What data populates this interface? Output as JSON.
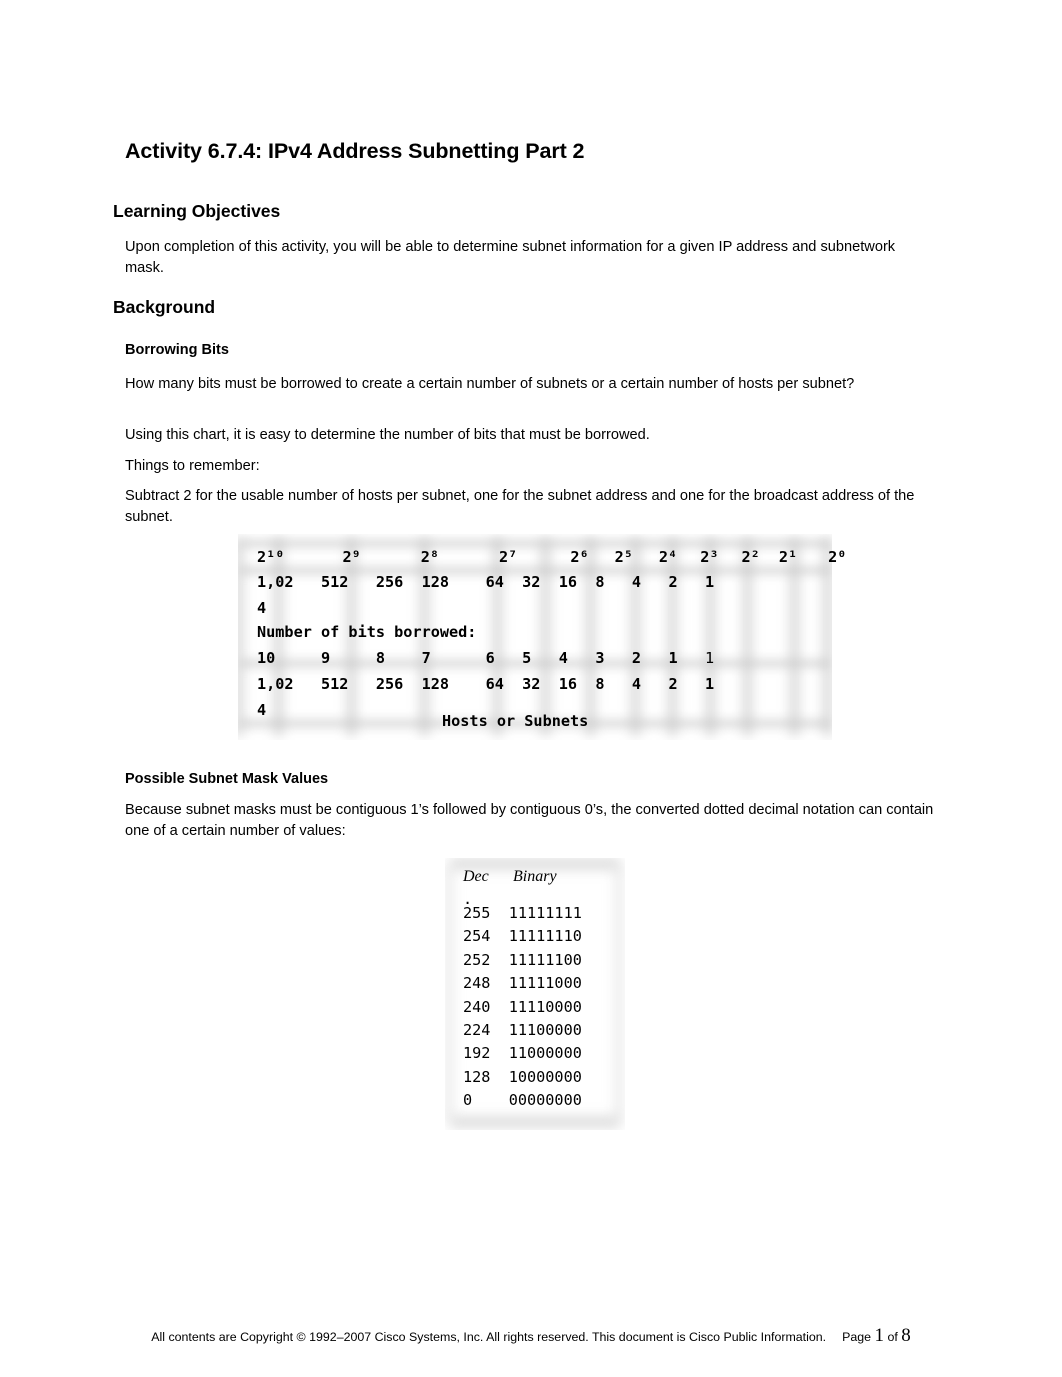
{
  "document": {
    "title": "Activity 6.7.4: IPv4 Address Subnetting Part 2"
  },
  "sections": {
    "learning_objectives": {
      "heading": "Learning Objectives",
      "body": "Upon completion of this activity, you will be able to determine subnet information for a given IP address and subnetwork mask."
    },
    "background": {
      "heading": "Background",
      "borrowing_bits": {
        "heading": "Borrowing Bits",
        "p1": "How many bits must be borrowed to create a certain number of subnets or a certain number of hosts per subnet?",
        "p2": "Using this chart, it is easy to determine the number of bits that must be borrowed.",
        "p3": "Things to remember:",
        "p4": "Subtract 2 for the usable number of hosts per subnet, one for the subnet address and one for the broadcast address of the subnet."
      },
      "subnet_mask_values": {
        "heading": "Possible Subnet Mask Values",
        "p1": "Because subnet masks must be contiguous 1’s followed by contiguous 0’s, the converted dotted decimal notation can contain one of a certain number of values:"
      }
    }
  },
  "chart_data": {
    "type": "table",
    "title": "Borrowing Bits chart",
    "footer_label": "Hosts or Subnets",
    "mid_label": "Number of bits borrowed:",
    "powers_row": [
      "2¹⁰",
      "2⁹",
      "2⁸",
      "2⁷",
      "2⁶",
      "2⁵",
      "2⁴",
      "2³",
      "2²",
      "2¹",
      "2⁰"
    ],
    "powers_base": [
      "2",
      "2",
      "2",
      "2",
      "2",
      "2",
      "2",
      "2",
      "2",
      "2",
      "2"
    ],
    "powers_exp": [
      "10",
      "9",
      "8",
      "7",
      "6",
      "5",
      "4",
      "3",
      "2",
      "1",
      "0"
    ],
    "values_row_top": [
      "1,024",
      "512",
      "256",
      "128",
      "64",
      "32",
      "16",
      "8",
      "4",
      "2",
      "1"
    ],
    "bits_borrowed_row": [
      "10",
      "9",
      "8",
      "7",
      "6",
      "5",
      "4",
      "3",
      "2",
      "1",
      "1"
    ],
    "values_row_bottom": [
      "1,024",
      "512",
      "256",
      "128",
      "64",
      "32",
      "16",
      "8",
      "4",
      "2",
      "1"
    ],
    "line_top_powers": "2          2        2      2        2   2   2   2   2   2   2",
    "line_top_values": "1,02   512   256  128    64  32  16  8   4   2   1",
    "line_top_wrap": "4",
    "line_mid": "Number of bits borrowed:",
    "line_bits": "10     9     8    7      6   5   4   3   2   1   ",
    "line_bits_tail": "1",
    "line_bottom_values": "1,02   512   256  128    64  32  16  8   4   2   1",
    "line_bottom_wrap": "4",
    "line_footer": "Hosts or Subnets"
  },
  "mask_table": {
    "type": "table",
    "columns": [
      "Dec",
      "Binary"
    ],
    "stray_mark": ".",
    "rows": [
      {
        "dec": "255",
        "binary": "11111111"
      },
      {
        "dec": "254",
        "binary": "11111110"
      },
      {
        "dec": "252",
        "binary": "11111100"
      },
      {
        "dec": "248",
        "binary": "11111000"
      },
      {
        "dec": "240",
        "binary": "11110000"
      },
      {
        "dec": "224",
        "binary": "11100000"
      },
      {
        "dec": "192",
        "binary": "11000000"
      },
      {
        "dec": "128",
        "binary": "10000000"
      },
      {
        "dec": "0",
        "binary": "00000000"
      }
    ],
    "rows_text": "255  11111111\n254  11111110\n252  11111100\n248  11111000\n240  11110000\n224  11100000\n192  11000000\n128  10000000\n0    00000000"
  },
  "footer": {
    "copyright": "All contents are Copyright © 1992–2007 Cisco Systems, Inc. All rights reserved. This document is Cisco Public Information.",
    "page_word": "Page",
    "page_number": "1",
    "of_word": "of",
    "page_total": "8"
  }
}
